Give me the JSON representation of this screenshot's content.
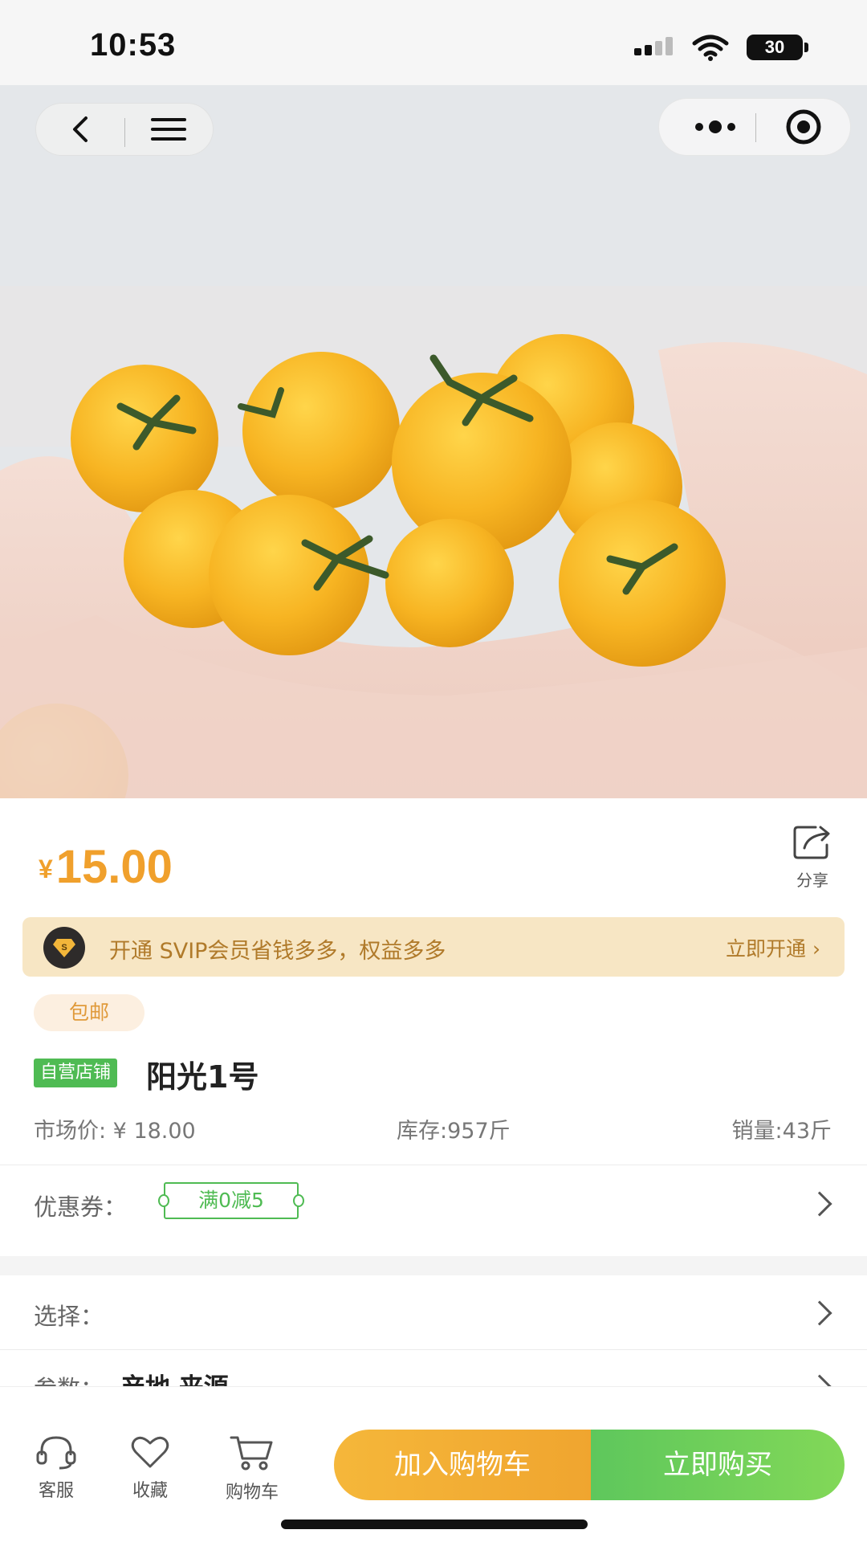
{
  "status_bar": {
    "time": "10:53",
    "battery": "30"
  },
  "hero": {
    "image": "yellow-cherry-tomatoes-in-hands-photo",
    "dots_total": 9,
    "active_dot": 1
  },
  "price": {
    "currency": "¥",
    "amount": "15.00"
  },
  "share": {
    "label": "分享"
  },
  "svip": {
    "text": "开通 SVIP会员省钱多多，权益多多",
    "link": "立即开通 ›"
  },
  "tags": {
    "free_shipping": "包邮",
    "self_store": "自营店铺"
  },
  "product": {
    "title": "阳光1号",
    "market_price": "市场价: ¥ 18.00",
    "stock": "库存:957斤",
    "sales": "销量:43斤"
  },
  "coupon": {
    "label": "优惠券：",
    "value": "满0减5"
  },
  "select": {
    "label": "选择："
  },
  "params": {
    "label": "参数：",
    "value": "产地 来源"
  },
  "bottom": {
    "service": "客服",
    "favorite": "收藏",
    "cart": "购物车",
    "add_to_cart": "加入购物车",
    "buy_now": "立即购买"
  },
  "colors": {
    "price": "#f0a02c",
    "green": "#4fbb53",
    "orange_btn": "#f5b73a",
    "green_btn": "#6dcd5a",
    "active_dot": "#e84c3d"
  }
}
